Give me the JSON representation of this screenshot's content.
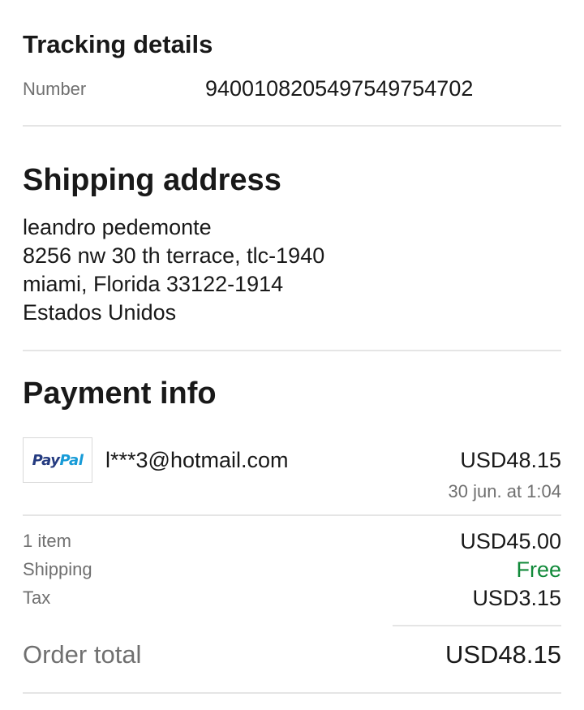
{
  "tracking": {
    "title": "Tracking details",
    "number_label": "Number",
    "number_value": "9400108205497549754702"
  },
  "shipping": {
    "title": "Shipping address",
    "lines": [
      "leandro pedemonte",
      "8256 nw 30 th terrace, tlc-1940",
      "miami, Florida 33122-1914",
      "Estados Unidos"
    ]
  },
  "payment": {
    "title": "Payment info",
    "method_logo": {
      "pay": "Pay",
      "pal": "Pal"
    },
    "account": "l***3@hotmail.com",
    "amount": "USD48.15",
    "date": "30 jun. at 1:04"
  },
  "summary": {
    "items_label": "1 item",
    "items_value": "USD45.00",
    "shipping_label": "Shipping",
    "shipping_value": "Free",
    "tax_label": "Tax",
    "tax_value": "USD3.15",
    "total_label": "Order total",
    "total_value": "USD48.15"
  },
  "colors": {
    "text": "#191919",
    "muted": "#707070",
    "free": "#118a3a",
    "divider": "#e5e5e5",
    "paypal_dark": "#253b80",
    "paypal_light": "#179bd7"
  }
}
